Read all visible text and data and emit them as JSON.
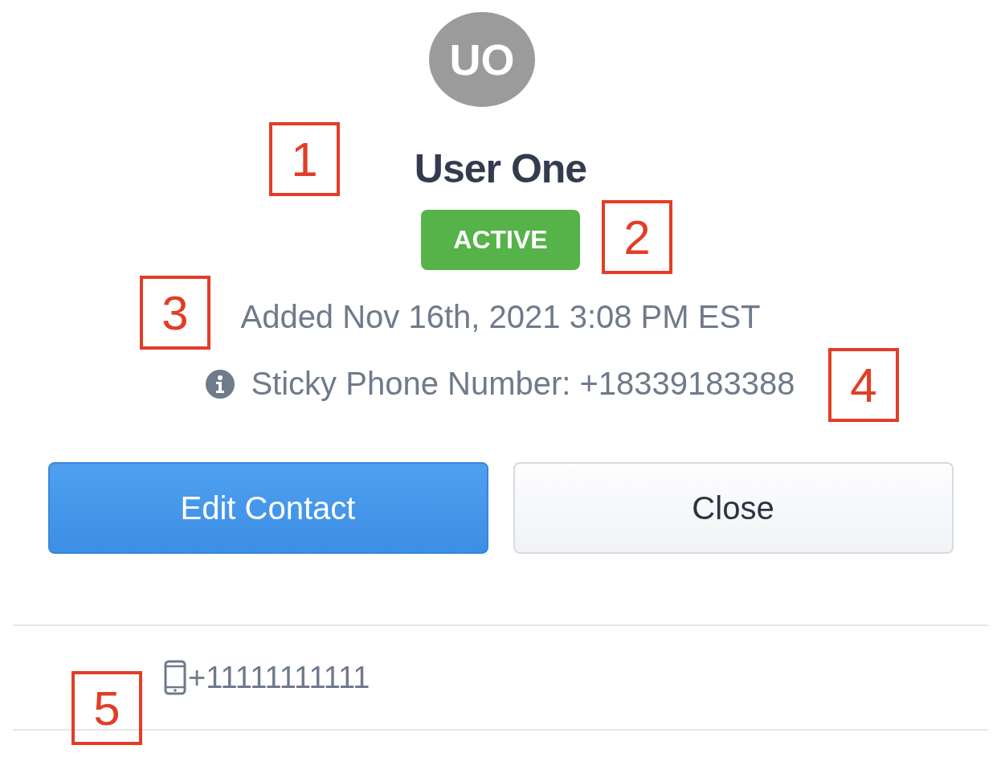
{
  "contact": {
    "initials": "UO",
    "name": "User One",
    "status": {
      "label": "ACTIVE",
      "kind": "active"
    },
    "added": "Added Nov 16th, 2021 3:08 PM EST",
    "sticky": "Sticky Phone Number: +18339183388"
  },
  "buttons": [
    {
      "label": "Edit Contact",
      "kind": "primary"
    },
    {
      "label": "Close",
      "kind": "secondary"
    }
  ],
  "phones": [
    {
      "number": "+11111111111"
    }
  ],
  "callouts": [
    "1",
    "2",
    "3",
    "4",
    "5"
  ]
}
